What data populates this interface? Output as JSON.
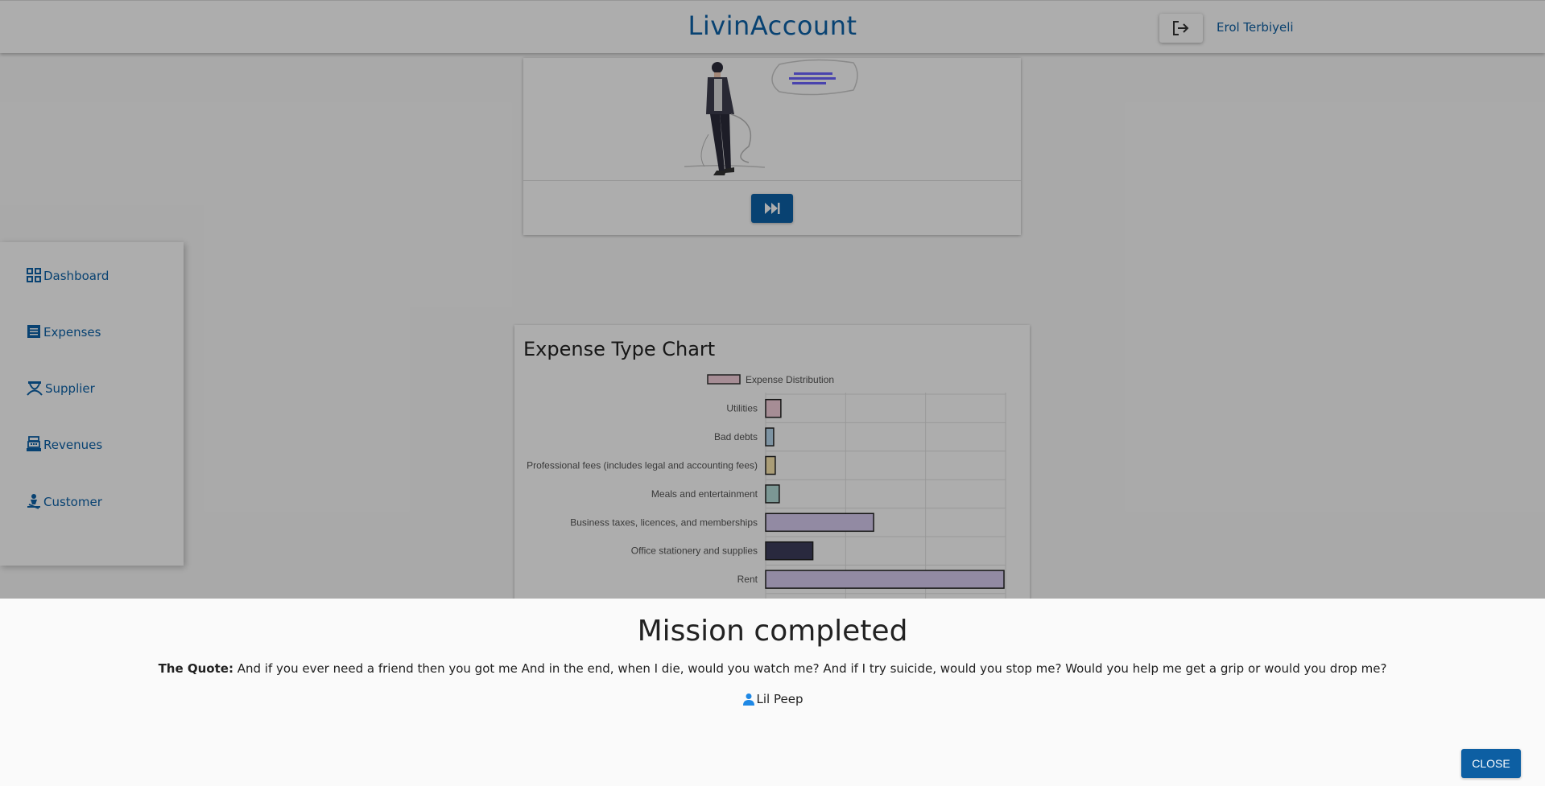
{
  "header": {
    "title": "LivinAccount",
    "user_name": "Erol Terbiyeli"
  },
  "sidebar": {
    "items": [
      {
        "label": "Dashboard",
        "icon": "dashboard-icon"
      },
      {
        "label": "Expenses",
        "icon": "list-icon"
      },
      {
        "label": "Supplier",
        "icon": "scale-icon"
      },
      {
        "label": "Revenues",
        "icon": "cash-register-icon"
      },
      {
        "label": "Customer",
        "icon": "person-icon"
      }
    ]
  },
  "chart_data": {
    "type": "bar",
    "orientation": "horizontal",
    "title": "Expense Type Chart",
    "legend": "Expense Distribution",
    "categories": [
      "Utilities",
      "Bad debts",
      "Professional fees (includes legal and accounting fees)",
      "Meals and entertainment",
      "Business taxes, licences, and memberships",
      "Office stationery and supplies",
      "Rent"
    ],
    "values": [
      19,
      10,
      12,
      17,
      135,
      59,
      298
    ],
    "xlim": [
      0,
      300
    ],
    "colors": [
      "#f5d0dc",
      "#b8d9ef",
      "#fbe7b0",
      "#b6dfdb",
      "#d7ccf0",
      "#3d3d5c",
      "#d7ccf0"
    ],
    "grid": true
  },
  "modal": {
    "title": "Mission completed",
    "quote_label": "The Quote:",
    "quote_text": "And if you ever need a friend then you got me And in the end, when I die, would you watch me? And if I try suicide, would you stop me? Would you help me get a grip or would you drop me?",
    "author": "Lil Peep",
    "close_label": "CLOSE"
  }
}
